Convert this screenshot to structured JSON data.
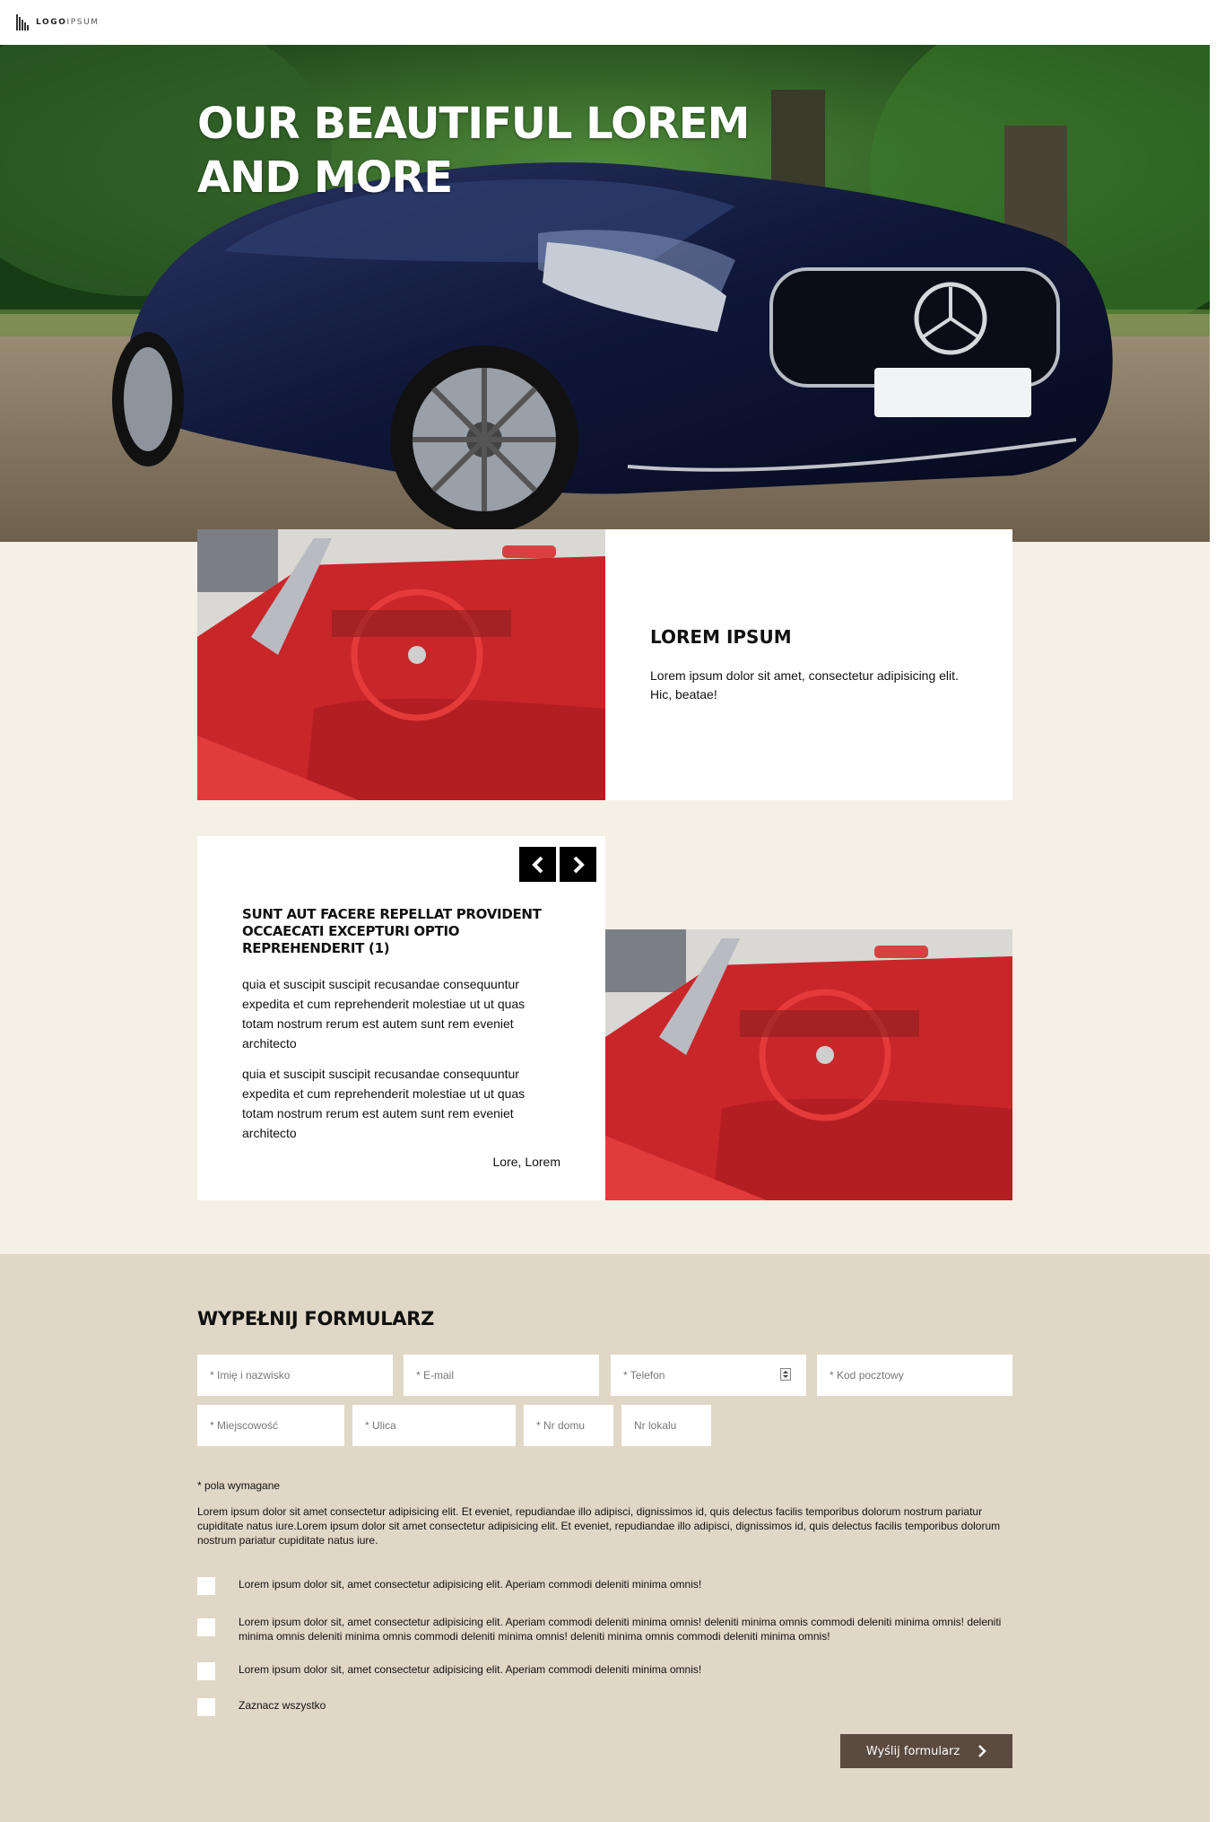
{
  "header": {
    "logo_bold": "LOGO",
    "logo_light": "IPSUM"
  },
  "hero": {
    "title": "OUR BEAUTIFUL LOREM AND MORE"
  },
  "feature": {
    "title": "LOREM IPSUM",
    "text": "Lorem ipsum dolor sit amet, consectetur adipisicing elit. Hic, beatae!"
  },
  "testimonial": {
    "title": "SUNT AUT FACERE REPELLAT PROVIDENT OCCAECATI EXCEPTURI OPTIO REPREHENDERIT (1)",
    "paragraph1": "quia et suscipit suscipit recusandae consequuntur expedita et cum reprehenderit molestiae ut ut quas totam nostrum rerum est autem sunt rem eveniet architecto",
    "paragraph2": "quia et suscipit suscipit recusandae consequuntur expedita et cum reprehenderit molestiae ut ut quas totam nostrum rerum est autem sunt rem eveniet architecto",
    "author": "Lore, Lorem"
  },
  "form": {
    "title": "WYPEŁNIJ FORMULARZ",
    "fields": {
      "name": "* Imię i nazwisko",
      "email": "* E-mail",
      "phone": "* Telefon",
      "postal": "* Kod pocztowy",
      "city": "* Miejscowość",
      "street": "* Ulica",
      "house": "* Nr domu",
      "flat": "Nr lokalu"
    },
    "required_note": "* pola wymagane",
    "lead": "Lorem ipsum dolor sit amet consectetur adipisicing elit. Et eveniet, repudiandae illo adipisci, dignissimos id, quis delectus facilis temporibus dolorum nostrum pariatur cupiditate natus iure.Lorem ipsum dolor sit amet consectetur adipisicing elit. Et eveniet, repudiandae illo adipisci, dignissimos id, quis delectus facilis temporibus dolorum nostrum pariatur cupiditate natus iure.",
    "consents": [
      "Lorem ipsum dolor sit, amet consectetur adipisicing elit. Aperiam commodi deleniti minima omnis!",
      "Lorem ipsum dolor sit, amet consectetur adipisicing elit. Aperiam commodi deleniti minima omnis! deleniti minima omnis commodi deleniti minima omnis! deleniti minima omnis deleniti minima omnis commodi deleniti minima omnis! deleniti minima omnis commodi deleniti minima omnis!",
      "Lorem ipsum dolor sit, amet consectetur adipisicing elit. Aperiam commodi deleniti minima omnis!",
      "Zaznacz wszystko"
    ],
    "submit_label": "Wyślij formularz"
  },
  "colors": {
    "cream": "#f4f0e6",
    "form_bg": "#e0d7c6",
    "button": "#5b4a3f"
  }
}
